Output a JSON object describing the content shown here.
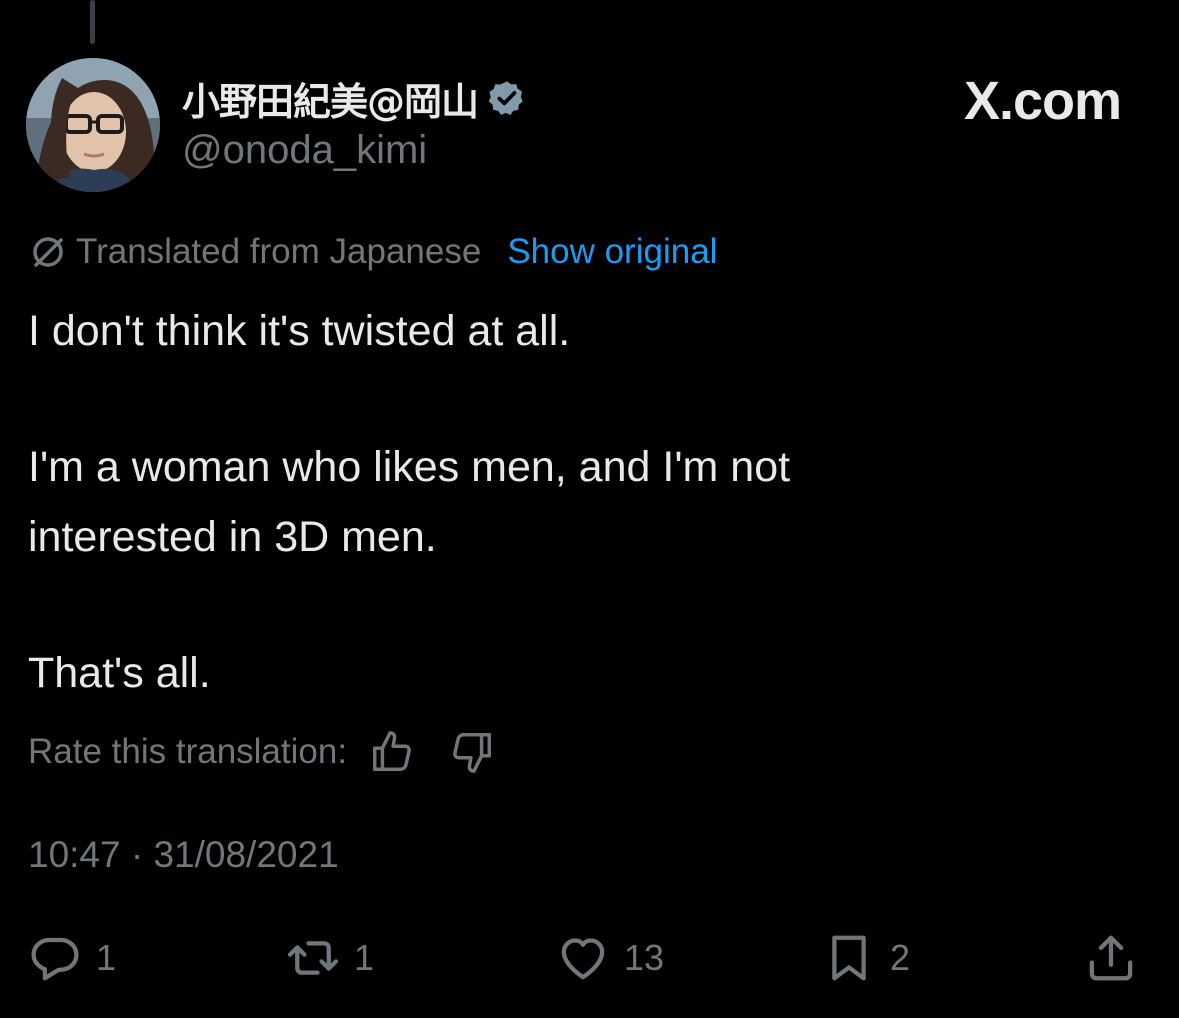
{
  "author": {
    "display_name": "小野田紀美@岡山",
    "handle": "@onoda_kimi",
    "verified_icon": "verified-badge-icon"
  },
  "brand": "X.com",
  "translation": {
    "icon": "translate-icon",
    "label": "Translated from Japanese",
    "show_original": "Show original"
  },
  "tweet": {
    "paragraphs": [
      "I don't think it's twisted at all.",
      "I'm a woman who likes men, and I'm not interested in 3D men.",
      "That's all."
    ]
  },
  "rate": {
    "label": "Rate this translation:",
    "thumbs_up_icon": "thumbs-up-icon",
    "thumbs_down_icon": "thumbs-down-icon"
  },
  "timestamp": "10:47 · 31/08/2021",
  "actions": {
    "reply": {
      "icon": "reply-icon",
      "count": "1"
    },
    "retweet": {
      "icon": "retweet-icon",
      "count": "1"
    },
    "like": {
      "icon": "heart-icon",
      "count": "13"
    },
    "bookmark": {
      "icon": "bookmark-icon",
      "count": "2"
    },
    "share": {
      "icon": "share-icon"
    }
  },
  "colors": {
    "background": "#000000",
    "text_primary": "#e7e9ea",
    "text_secondary": "#71767b",
    "link": "#1d9bf0"
  }
}
